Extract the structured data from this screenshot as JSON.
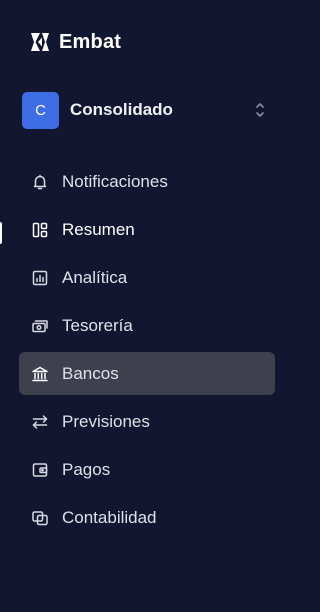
{
  "brand": {
    "name": "Embat",
    "icon": "embat-logo-icon"
  },
  "organization": {
    "avatar_letter": "C",
    "name": "Consolidado",
    "avatar_color": "#3e6ce5",
    "selector_icon": "chevron-up-down-icon"
  },
  "nav": {
    "items": [
      {
        "label": "Notificaciones",
        "icon": "bell-icon"
      },
      {
        "label": "Resumen",
        "icon": "dashboard-layout-icon",
        "current": true
      },
      {
        "label": "Analítica",
        "icon": "bar-chart-icon"
      },
      {
        "label": "Tesorería",
        "icon": "banknote-icon"
      },
      {
        "label": "Bancos",
        "icon": "bank-icon",
        "highlighted": true
      },
      {
        "label": "Previsiones",
        "icon": "arrows-exchange-icon"
      },
      {
        "label": "Pagos",
        "icon": "wallet-icon"
      },
      {
        "label": "Contabilidad",
        "icon": "copy-ledger-icon"
      }
    ]
  },
  "colors": {
    "background": "#131631",
    "highlight": "#3e404e",
    "accent": "#3e6ce5"
  }
}
